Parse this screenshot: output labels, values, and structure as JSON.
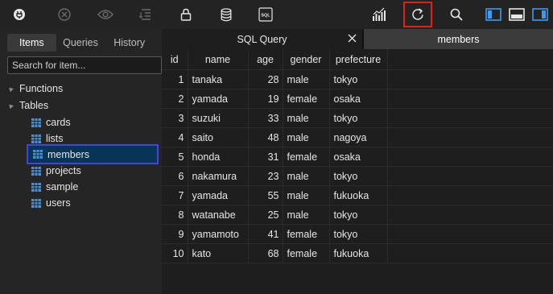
{
  "toolbar": {
    "buttons": [
      {
        "name": "plugin-icon"
      },
      {
        "name": "cancel-icon"
      },
      {
        "name": "preview-icon"
      },
      {
        "name": "format-icon"
      },
      {
        "name": "lock-icon"
      },
      {
        "name": "database-icon"
      },
      {
        "name": "sql-icon",
        "label": "SQL"
      },
      {
        "name": "chart-icon"
      },
      {
        "name": "refresh-icon"
      },
      {
        "name": "search-icon"
      },
      {
        "name": "toggle-left-panel-icon"
      },
      {
        "name": "toggle-bottom-panel-icon"
      },
      {
        "name": "toggle-right-panel-icon"
      }
    ],
    "accent": "#3b9bf0",
    "highlight": "#e0201a"
  },
  "sidebar": {
    "tabs": [
      "Items",
      "Queries",
      "History"
    ],
    "active_tab": "Items",
    "search_placeholder": "Search for item...",
    "groups": {
      "functions": "Functions",
      "tables": "Tables"
    },
    "tables": [
      "cards",
      "lists",
      "members",
      "projects",
      "sample",
      "users"
    ],
    "selected": "members",
    "table_icon_color": "#4a8fd0"
  },
  "tabs": {
    "sql": "SQL Query",
    "members": "members"
  },
  "grid": {
    "columns": [
      "id",
      "name",
      "age",
      "gender",
      "prefecture"
    ],
    "rows": [
      [
        "1",
        "tanaka",
        "28",
        "male",
        "tokyo"
      ],
      [
        "2",
        "yamada",
        "19",
        "female",
        "osaka"
      ],
      [
        "3",
        "suzuki",
        "33",
        "male",
        "tokyo"
      ],
      [
        "4",
        "saito",
        "48",
        "male",
        "nagoya"
      ],
      [
        "5",
        "honda",
        "31",
        "female",
        "osaka"
      ],
      [
        "6",
        "nakamura",
        "23",
        "male",
        "tokyo"
      ],
      [
        "7",
        "yamada",
        "55",
        "male",
        "fukuoka"
      ],
      [
        "8",
        "watanabe",
        "25",
        "male",
        "tokyo"
      ],
      [
        "9",
        "yamamoto",
        "41",
        "female",
        "tokyo"
      ],
      [
        "10",
        "kato",
        "68",
        "female",
        "fukuoka"
      ]
    ]
  }
}
